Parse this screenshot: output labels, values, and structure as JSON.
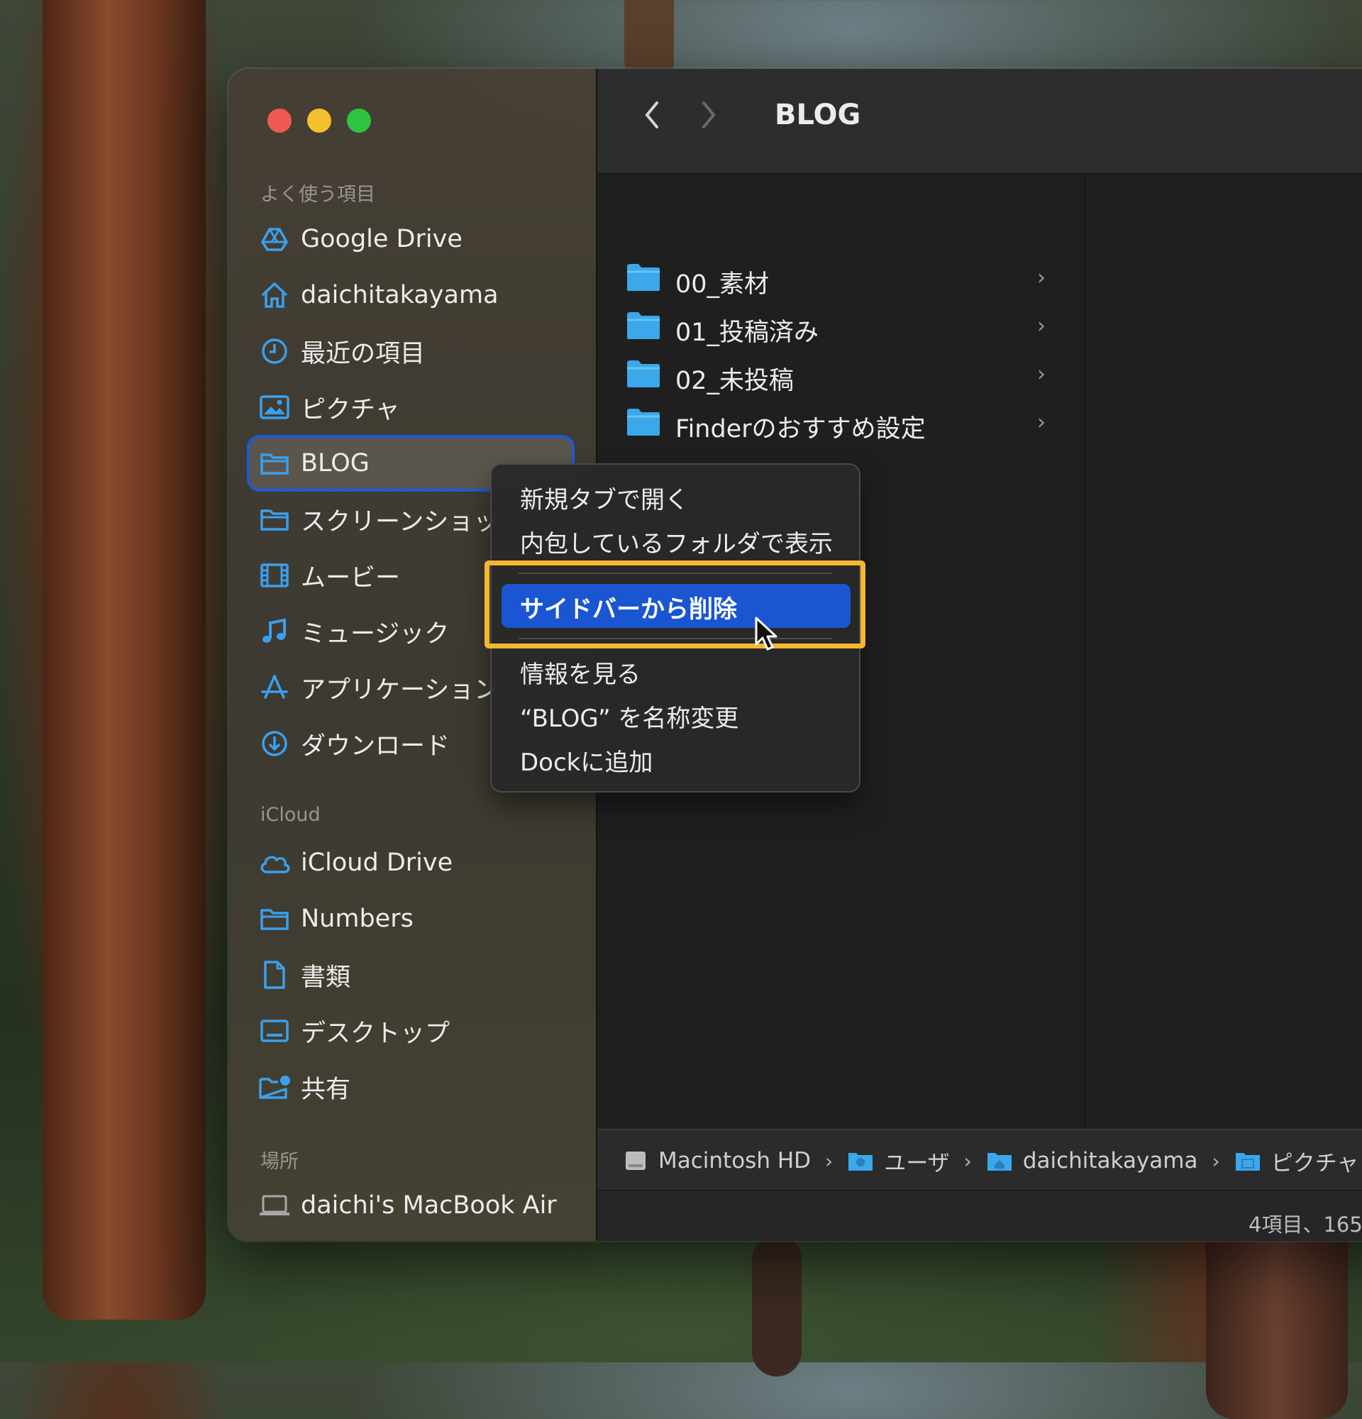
{
  "window": {
    "title": "BLOG"
  },
  "traffic_lights": {
    "close_color": "#ee5a52",
    "minimize_color": "#f4bf30",
    "zoom_color": "#2fc43f"
  },
  "sidebar": {
    "favorites_label": "よく使う項目",
    "favorites": [
      {
        "label": "Google Drive",
        "icon": "google-drive-icon"
      },
      {
        "label": "daichitakayama",
        "icon": "home-icon"
      },
      {
        "label": "最近の項目",
        "icon": "clock-icon"
      },
      {
        "label": "ピクチャ",
        "icon": "photo-icon"
      },
      {
        "label": "BLOG",
        "icon": "folder-icon"
      },
      {
        "label": "スクリーンショッ",
        "icon": "folder-icon"
      },
      {
        "label": "ムービー",
        "icon": "film-icon"
      },
      {
        "label": "ミュージック",
        "icon": "music-note-icon"
      },
      {
        "label": "アプリケーション",
        "icon": "applications-icon"
      },
      {
        "label": "ダウンロード",
        "icon": "download-icon"
      }
    ],
    "icloud_label": "iCloud",
    "icloud": [
      {
        "label": "iCloud Drive",
        "icon": "cloud-icon"
      },
      {
        "label": "Numbers",
        "icon": "folder-icon"
      },
      {
        "label": "書類",
        "icon": "document-icon"
      },
      {
        "label": "デスクトップ",
        "icon": "desktop-icon"
      },
      {
        "label": "共有",
        "icon": "shared-folder-icon"
      }
    ],
    "locations_label": "場所",
    "locations": [
      {
        "label": "daichi's MacBook Air",
        "icon": "laptop-icon"
      }
    ]
  },
  "files": [
    {
      "name": "00_素材"
    },
    {
      "name": "01_投稿済み"
    },
    {
      "name": "02_未投稿"
    },
    {
      "name": "Finderのおすすめ設定"
    }
  ],
  "context_menu": {
    "items": [
      "新規タブで開く",
      "内包しているフォルダで表示",
      "サイドバーから削除",
      "情報を見る",
      "“BLOG” を名称変更",
      "Dockに追加"
    ],
    "highlighted_index": 2
  },
  "path_bar": [
    "Macintosh HD",
    "ユーザ",
    "daichitakayama",
    "ピクチャ"
  ],
  "status": {
    "text": "4項目、165"
  },
  "colors": {
    "accent": "#1a55d2",
    "folder": "#3aa8ea",
    "sidebar_icon": "#3aa0ee",
    "annotation": "#f5b72f"
  }
}
